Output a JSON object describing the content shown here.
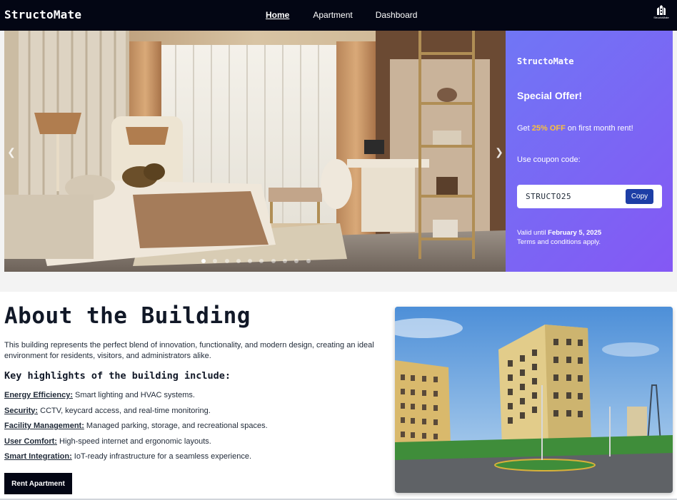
{
  "navbar": {
    "brand": "StructoMate",
    "links": [
      "Home",
      "Apartment",
      "Dashboard"
    ],
    "active_link": "Home",
    "logo_text": "StructoMate",
    "logo_icon": "building-logo-icon"
  },
  "carousel": {
    "image": "bedroom-photo",
    "prev_icon": "chevron-left-icon",
    "next_icon": "chevron-right-icon",
    "slide_count": 10,
    "active_slide": 1
  },
  "offer": {
    "brand": "StructoMate",
    "title": "Special Offer!",
    "discount_prefix": "Get ",
    "discount_highlight": "25% OFF",
    "discount_suffix": " on first month rent!",
    "coupon_label": "Use coupon code:",
    "coupon_code": "STRUCTO25",
    "copy_label": "Copy",
    "valid_prefix": "Valid until ",
    "valid_date": "February 5, 2025",
    "terms": "Terms and conditions apply.",
    "highlight_color": "#fcc23a"
  },
  "about": {
    "title": "About the Building",
    "description": "This building represents the perfect blend of innovation, functionality, and modern design, creating an ideal environment for residents, visitors, and administrators alike.",
    "subtitle": "Key highlights of the building include:",
    "highlights": [
      {
        "key": "Energy Efficiency:",
        "text": " Smart lighting and HVAC systems."
      },
      {
        "key": "Security:",
        "text": " CCTV, keycard access, and real-time monitoring."
      },
      {
        "key": "Facility Management:",
        "text": " Managed parking, storage, and recreational spaces."
      },
      {
        "key": "User Comfort:",
        "text": " High-speed internet and ergonomic layouts."
      },
      {
        "key": "Smart Integration:",
        "text": " IoT-ready infrastructure for a seamless experience."
      }
    ],
    "button_label": "Rent Apartment",
    "image": "apartment-building-photo"
  },
  "colors": {
    "navbar_bg": "#030614",
    "offer_gradient_start": "#7076f5",
    "offer_gradient_end": "#8458f4",
    "copy_button": "#1d3ea6"
  }
}
